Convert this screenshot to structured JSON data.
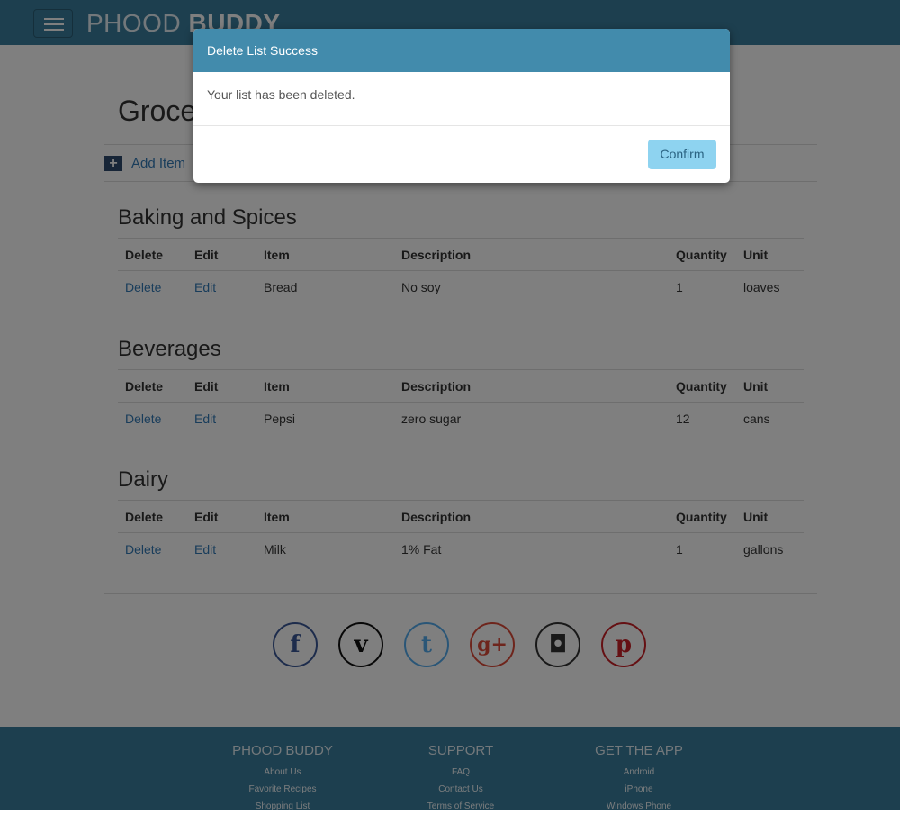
{
  "header": {
    "brand_part1": "PHOOD",
    "brand_part2": "BUDDY",
    "menu_icon": "hamburger-icon"
  },
  "page": {
    "title": "Groce",
    "add_item_label": "Add Item",
    "add_item_icon": "plus-square-icon"
  },
  "table_headers": {
    "delete": "Delete",
    "edit": "Edit",
    "item": "Item",
    "description": "Description",
    "quantity": "Quantity",
    "unit": "Unit"
  },
  "categories": [
    {
      "name": "Baking and Spices",
      "rows": [
        {
          "delete": "Delete",
          "edit": "Edit",
          "item": "Bread",
          "description": "No soy",
          "quantity": "1",
          "unit": "loaves"
        }
      ]
    },
    {
      "name": "Beverages",
      "rows": [
        {
          "delete": "Delete",
          "edit": "Edit",
          "item": "Pepsi",
          "description": "zero sugar",
          "quantity": "12",
          "unit": "cans"
        }
      ]
    },
    {
      "name": "Dairy",
      "rows": [
        {
          "delete": "Delete",
          "edit": "Edit",
          "item": "Milk",
          "description": "1% Fat",
          "quantity": "1",
          "unit": "gallons"
        }
      ]
    }
  ],
  "social": [
    {
      "name": "facebook-icon",
      "glyph": "f",
      "color": "#3b5998"
    },
    {
      "name": "vimeo-icon",
      "glyph": "v",
      "color": "#111111"
    },
    {
      "name": "twitter-icon",
      "glyph": "t",
      "color": "#55acee"
    },
    {
      "name": "google-plus-icon",
      "glyph": "g+",
      "color": "#dd4b39"
    },
    {
      "name": "instagram-icon",
      "glyph": "◘",
      "color": "#333333"
    },
    {
      "name": "pinterest-icon",
      "glyph": "p",
      "color": "#cb2027"
    }
  ],
  "footer": {
    "columns": [
      {
        "heading": "PHOOD BUDDY",
        "links": [
          "About Us",
          "Favorite Recipes",
          "Shopping List"
        ]
      },
      {
        "heading": "SUPPORT",
        "links": [
          "FAQ",
          "Contact Us",
          "Terms of Service"
        ]
      },
      {
        "heading": "GET THE APP",
        "links": [
          "Android",
          "iPhone",
          "Windows Phone"
        ]
      }
    ]
  },
  "modal": {
    "title": "Delete List Success",
    "message": "Your list has been deleted.",
    "confirm_label": "Confirm"
  },
  "colors": {
    "brand": "#3b7f9f",
    "modal_header": "#428bac",
    "confirm_button": "#8ed3f0",
    "link": "#337ab7"
  }
}
